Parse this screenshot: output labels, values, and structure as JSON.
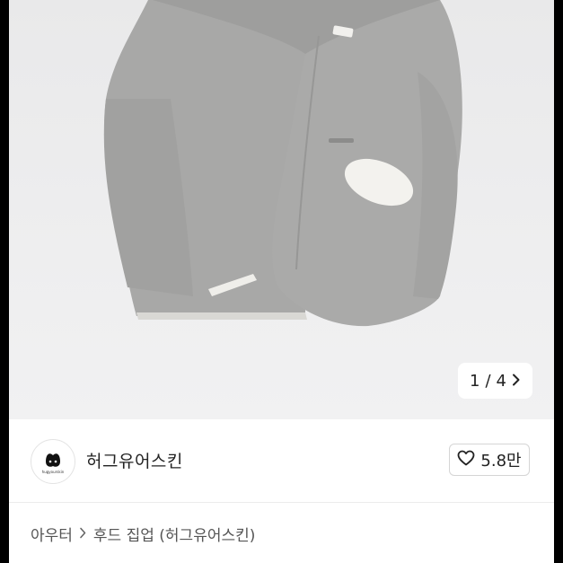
{
  "gallery": {
    "current_page": "1",
    "separator": "/",
    "total_pages": "4"
  },
  "seller": {
    "name": "허그유어스킨",
    "avatar_text": "hugyourskin"
  },
  "likes": {
    "count": "5.8만"
  },
  "breadcrumb": {
    "category": "아우터",
    "subcategory": "후드 집업 (허그유어스킨)"
  },
  "icons": {
    "like": "heart-icon",
    "next": "chevron-right-icon",
    "breadcrumb_separator": "chevron-right-icon"
  },
  "colors": {
    "gallery_background": "#ececed",
    "jacket": "#a7a7a6",
    "text_primary": "#222222"
  }
}
